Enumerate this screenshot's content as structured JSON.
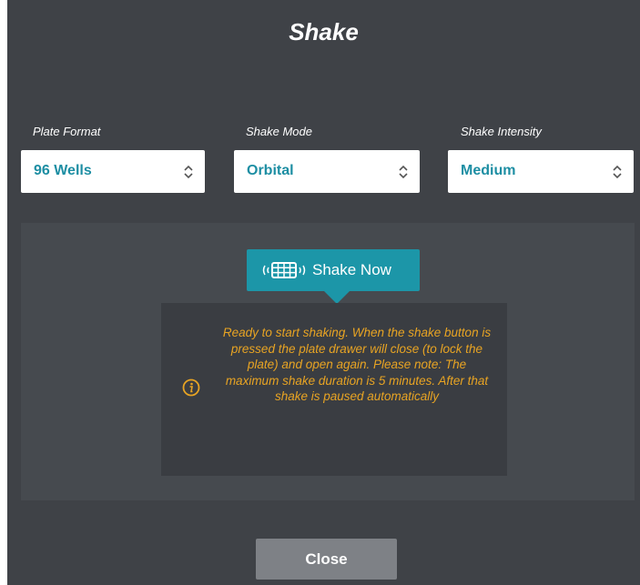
{
  "dialog": {
    "title": "Shake"
  },
  "fields": {
    "plate_format": {
      "label": "Plate Format",
      "value": "96 Wells"
    },
    "shake_mode": {
      "label": "Shake Mode",
      "value": "Orbital"
    },
    "shake_intensity": {
      "label": "Shake Intensity",
      "value": "Medium"
    }
  },
  "shake_button": {
    "label": "Shake Now",
    "icon": "shaking-plate-icon"
  },
  "info": {
    "icon": "info-icon",
    "message": "Ready to start shaking. When the shake button is pressed the plate drawer will close (to lock the plate) and open again. Please note: The maximum shake duration is 5 minutes. After that shake is paused automatically"
  },
  "close_button": {
    "label": "Close"
  },
  "colors": {
    "background": "#3f4247",
    "accent": "#1c96a8",
    "select_text": "#1d8ea3",
    "warning_text": "#e8a423",
    "close_button": "#7e8186"
  }
}
